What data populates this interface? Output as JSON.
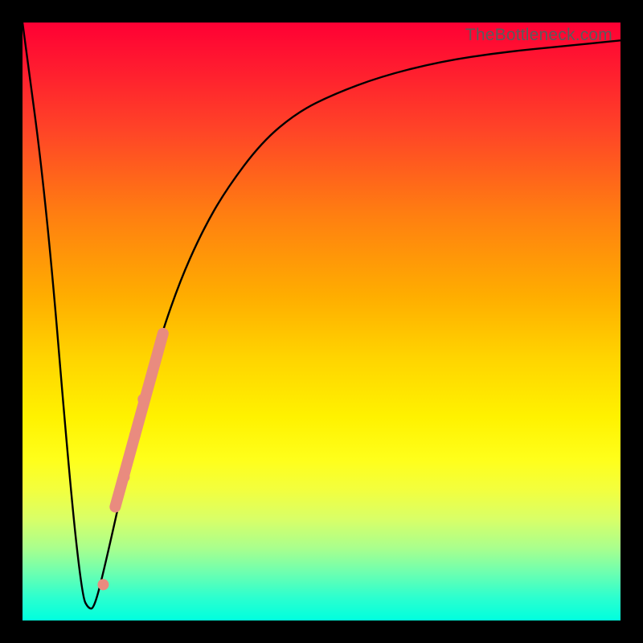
{
  "watermark": "TheBottleneck.com",
  "colors": {
    "line": "#000000",
    "marker": "#e98b7f",
    "frame": "#000000"
  },
  "chart_data": {
    "type": "line",
    "title": "",
    "xlabel": "",
    "ylabel": "",
    "xlim": [
      0,
      100
    ],
    "ylim": [
      0,
      100
    ],
    "series": [
      {
        "name": "curve",
        "x": [
          0,
          4,
          8,
          10,
          11,
          12,
          14,
          18,
          22,
          26,
          30,
          34,
          40,
          46,
          52,
          60,
          70,
          80,
          90,
          100
        ],
        "y": [
          100,
          70,
          22,
          4,
          2,
          2,
          10,
          28,
          44,
          56,
          65,
          72,
          80,
          85,
          88,
          91,
          93.5,
          95,
          96,
          97
        ]
      },
      {
        "name": "highlight-segment",
        "x": [
          15.5,
          23.5
        ],
        "y": [
          19,
          48
        ]
      }
    ],
    "markers": [
      {
        "x": 13.5,
        "y": 6
      },
      {
        "x": 17.0,
        "y": 24
      },
      {
        "x": 18.8,
        "y": 31
      },
      {
        "x": 20.2,
        "y": 37
      }
    ]
  }
}
